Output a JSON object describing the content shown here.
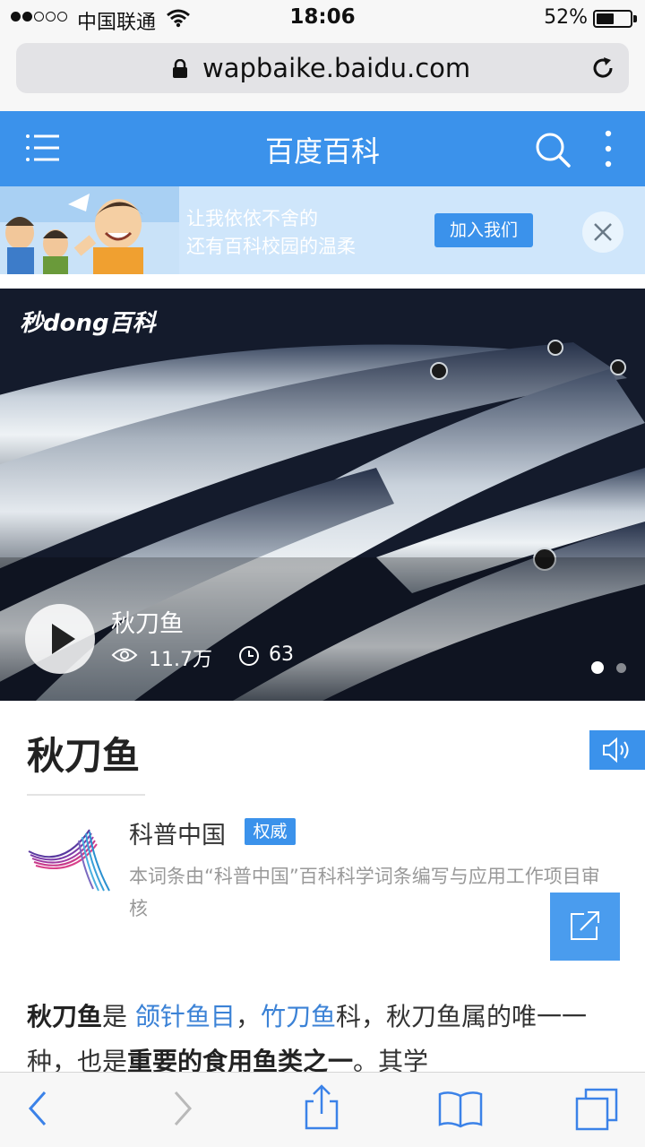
{
  "status_bar": {
    "carrier": "中国联通",
    "time": "18:06",
    "battery_percent": "52%",
    "battery_level": 0.52,
    "signal_bars_filled": 2,
    "signal_bars_total": 5
  },
  "browser": {
    "url": "wapbaike.baidu.com"
  },
  "app_header": {
    "title": "百度百科"
  },
  "banner": {
    "line1": "让我依依不舍的",
    "line2": "还有百科校园的温柔",
    "join_label": "加入我们"
  },
  "video": {
    "watermark": "秒dong百科",
    "title": "秋刀鱼",
    "views": "11.7万",
    "duration": "63"
  },
  "entry": {
    "title": "秋刀鱼",
    "org_name": "科普中国",
    "badge": "权威",
    "org_description": "本词条由“科普中国”百科科学词条编写与应用工作项目审核",
    "summary": {
      "term": "秋刀鱼",
      "text1": "是 ",
      "link1": "颌针鱼目",
      "text2": "，",
      "link2": "竹刀鱼",
      "text3": "科，秋刀鱼属的唯一一种，也是",
      "bold": "重要的食用鱼类之一",
      "text4": "。其学"
    }
  },
  "colors": {
    "accent": "#3b92eb",
    "link": "#3b82d6"
  },
  "icons": {
    "header": [
      "menu-icon",
      "search-icon",
      "more-icon"
    ],
    "toolbar": [
      "back-icon",
      "forward-icon",
      "share-icon",
      "bookmarks-icon",
      "tabs-icon"
    ]
  }
}
